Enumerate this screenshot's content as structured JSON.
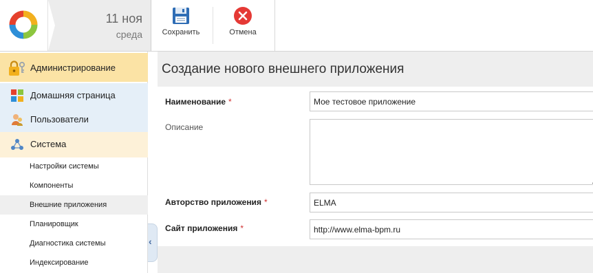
{
  "header": {
    "date_day": "11 ноя",
    "date_weekday": "среда",
    "save_label": "Сохранить",
    "cancel_label": "Отмена"
  },
  "sidebar": {
    "items": [
      {
        "label": "Администрирование",
        "icon": "lock-key-icon"
      },
      {
        "label": "Домашняя страница",
        "icon": "windows-grid-icon"
      },
      {
        "label": "Пользователи",
        "icon": "users-icon"
      },
      {
        "label": "Система",
        "icon": "network-icon"
      }
    ],
    "subitems": [
      "Настройки системы",
      "Компоненты",
      "Внешние приложения",
      "Планировщик",
      "Диагностика системы",
      "Индексирование"
    ]
  },
  "main": {
    "title": "Создание нового внешнего приложения",
    "fields": {
      "name_label": "Наименование",
      "name_value": "Мое тестовое приложение",
      "description_label": "Описание",
      "description_value": "",
      "author_label": "Авторство приложения",
      "author_value": "ELMA",
      "site_label": "Сайт приложения",
      "site_value": "http://www.elma-bpm.ru"
    },
    "required_mark": "*"
  },
  "colors": {
    "admin_bg": "#fbe3a5",
    "nav_bg": "#e5eff8",
    "system_bg": "#fdf1d8",
    "required": "#d03030",
    "cancel_red": "#e53935",
    "save_blue": "#2f6db5"
  }
}
